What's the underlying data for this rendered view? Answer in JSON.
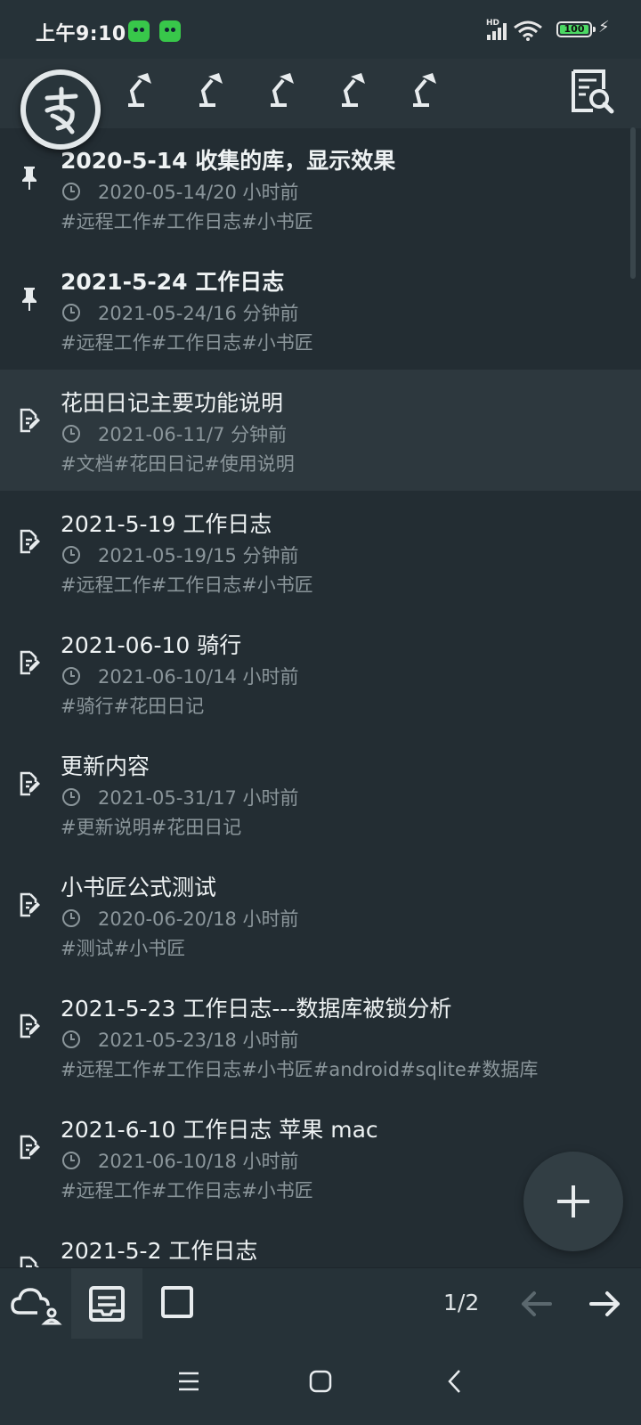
{
  "status_bar": {
    "time": "上午9:10",
    "network_label": "HD",
    "battery_level": "100",
    "battery_fraction": 1.0,
    "icons": [
      "app-notification-icon",
      "app-notification-icon",
      "signal-icon",
      "wifi-icon",
      "battery-icon",
      "charging-icon"
    ]
  },
  "toolbar": {
    "logo_icon": "app-logo-icon",
    "lamp_icons": [
      "lamp-icon",
      "lamp-icon",
      "lamp-icon",
      "lamp-icon",
      "lamp-icon"
    ],
    "search_icon": "search-document-icon"
  },
  "notes": [
    {
      "title": "2020-5-14 收集的库，显示效果",
      "time": "2020-05-14/20 小时前",
      "tags": "#远程工作#工作日志#小书匠",
      "icon": "pin-icon",
      "pinned": true,
      "active": false
    },
    {
      "title": "2021-5-24 工作日志",
      "time": "2021-05-24/16 分钟前",
      "tags": "#远程工作#工作日志#小书匠",
      "icon": "pin-icon",
      "pinned": true,
      "active": false
    },
    {
      "title": "花田日记主要功能说明",
      "time": "2021-06-11/7 分钟前",
      "tags": "#文档#花田日记#使用说明",
      "icon": "note-edit-icon",
      "pinned": false,
      "active": true
    },
    {
      "title": "2021-5-19 工作日志",
      "time": "2021-05-19/15 分钟前",
      "tags": "#远程工作#工作日志#小书匠",
      "icon": "note-edit-icon",
      "pinned": false,
      "active": false
    },
    {
      "title": "2021-06-10 骑行",
      "time": "2021-06-10/14 小时前",
      "tags": "#骑行#花田日记",
      "icon": "note-edit-icon",
      "pinned": false,
      "active": false
    },
    {
      "title": "更新内容",
      "time": "2021-05-31/17 小时前",
      "tags": "#更新说明#花田日记",
      "icon": "note-edit-icon",
      "pinned": false,
      "active": false
    },
    {
      "title": "小书匠公式测试",
      "time": "2020-06-20/18 小时前",
      "tags": "#测试#小书匠",
      "icon": "note-edit-icon",
      "pinned": false,
      "active": false
    },
    {
      "title": "2021-5-23 工作日志---数据库被锁分析",
      "time": "2021-05-23/18 小时前",
      "tags": "#远程工作#工作日志#小书匠#android#sqlite#数据库",
      "icon": "note-edit-icon",
      "pinned": false,
      "active": false
    },
    {
      "title": "2021-6-10 工作日志 苹果 mac",
      "time": "2021-06-10/18 小时前",
      "tags": "#远程工作#工作日志#小书匠",
      "icon": "note-edit-icon",
      "pinned": false,
      "active": false
    },
    {
      "title": "2021-5-2 工作日志",
      "time": "",
      "tags": "",
      "icon": "note-edit-icon",
      "pinned": false,
      "active": false
    }
  ],
  "fab": {
    "icon": "plus-icon"
  },
  "bottom_bar": {
    "cloud_icon": "cloud-user-icon",
    "inbox_icon": "inbox-icon",
    "square_icon": "square-icon",
    "page_indicator": "1/2",
    "prev_icon": "arrow-left-icon",
    "next_icon": "arrow-right-icon"
  },
  "nav_bar": {
    "icons": [
      "menu-icon",
      "home-icon",
      "back-icon"
    ]
  },
  "colors": {
    "background": "#232d33",
    "toolbar": "#2a353b",
    "active_row": "#2d383e",
    "text_primary": "#eef2f3",
    "text_secondary": "#8b969b",
    "battery_green": "#4cd964",
    "app_badge_green": "#38c74a"
  }
}
